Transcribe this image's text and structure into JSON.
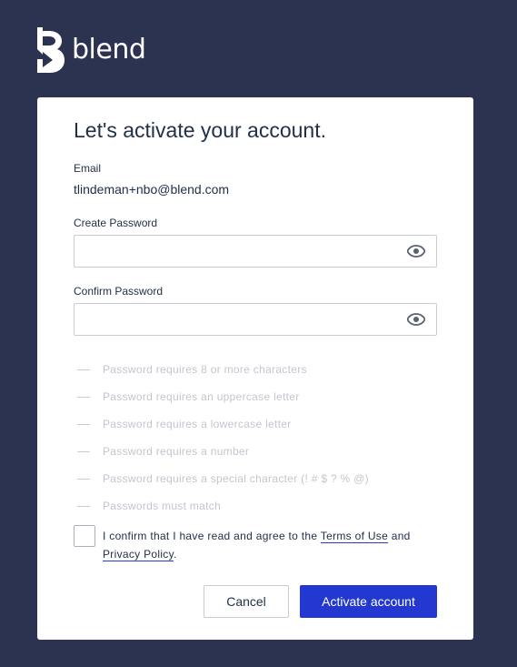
{
  "brand": {
    "name": "blend",
    "logo_icon": "blend-b-logo-icon"
  },
  "card": {
    "title": "Let's activate your account."
  },
  "email": {
    "label": "Email",
    "value": "tlindeman+nbo@blend.com"
  },
  "create_password": {
    "label": "Create Password",
    "value": "",
    "icon": "eye-icon"
  },
  "confirm_password": {
    "label": "Confirm Password",
    "value": "",
    "icon": "eye-icon"
  },
  "requirements": [
    "Password requires 8 or more characters",
    "Password requires an uppercase letter",
    "Password requires a lowercase letter",
    "Password requires a number",
    "Password requires a special character (! # $ ? % @)",
    "Passwords must match"
  ],
  "agreement": {
    "prefix": "I confirm that I have read and agree to the ",
    "terms_link": "Terms of Use",
    "middle": " and",
    "privacy_link": "Privacy Policy",
    "suffix": ".",
    "checked": false
  },
  "buttons": {
    "cancel": "Cancel",
    "activate": "Activate account"
  },
  "colors": {
    "background": "#2b3350",
    "primary": "#2238d0",
    "text": "#22304a",
    "muted": "#c2c6ce"
  }
}
